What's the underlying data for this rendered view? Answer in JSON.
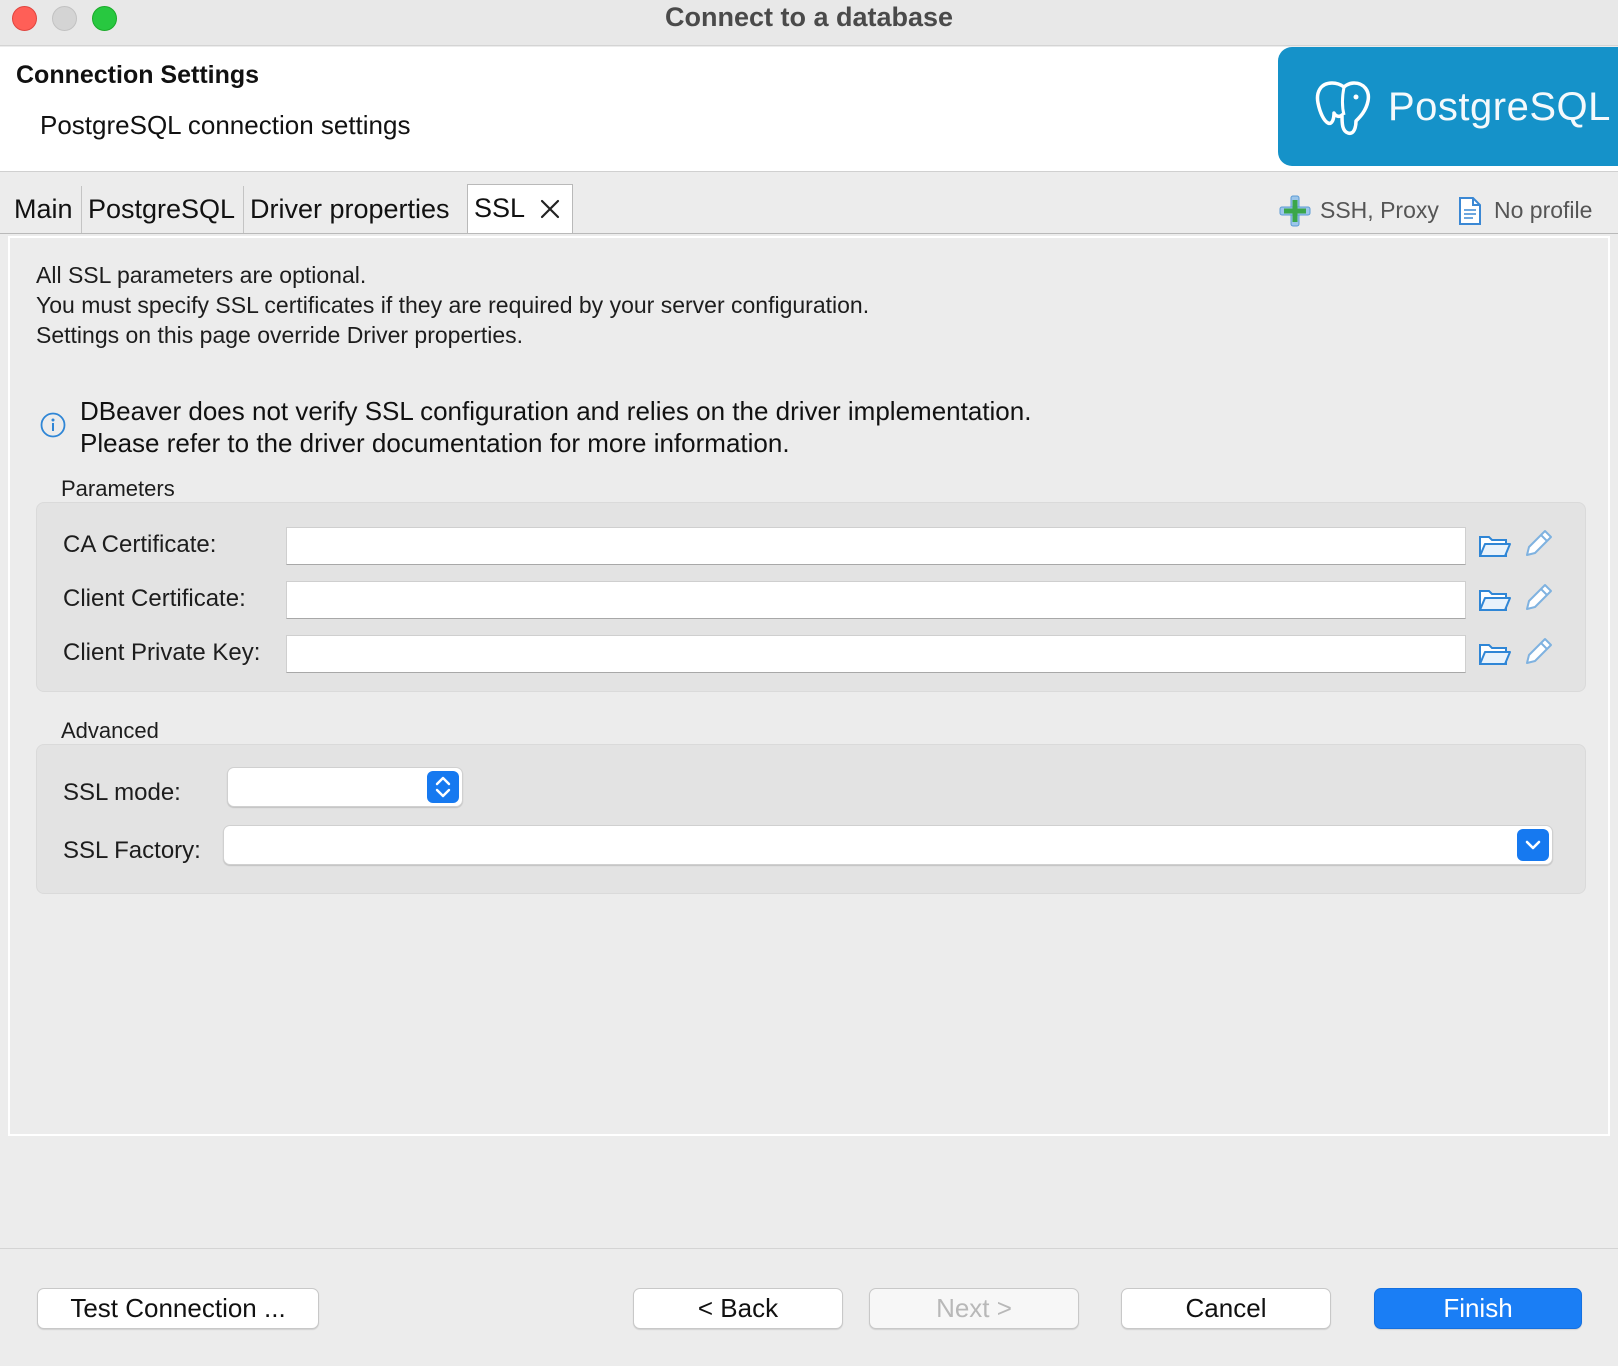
{
  "window": {
    "title": "Connect to a database"
  },
  "header": {
    "title": "Connection Settings",
    "subtitle": "PostgreSQL connection settings",
    "logo_text": "PostgreSQL",
    "logo_color": "#1592c9"
  },
  "tabs": [
    {
      "label": "Main",
      "active": false
    },
    {
      "label": "PostgreSQL",
      "active": false
    },
    {
      "label": "Driver properties",
      "active": false
    },
    {
      "label": "SSL",
      "active": true
    }
  ],
  "tools": {
    "ssh_proxy": "SSH, Proxy",
    "profile": "No profile"
  },
  "intro": {
    "line1": "All SSL parameters are optional.",
    "line2": "You must specify SSL certificates if they are required by your server configuration.",
    "line3": "Settings on this page override Driver properties."
  },
  "info": {
    "line1": "DBeaver does not verify SSL configuration and relies on the driver implementation.",
    "line2": "Please refer to the driver documentation for more information."
  },
  "parameters": {
    "label": "Parameters",
    "ca_certificate": {
      "label": "CA Certificate:",
      "value": ""
    },
    "client_certificate": {
      "label": "Client Certificate:",
      "value": ""
    },
    "client_private_key": {
      "label": "Client Private Key:",
      "value": ""
    }
  },
  "advanced": {
    "label": "Advanced",
    "ssl_mode": {
      "label": "SSL mode:",
      "value": ""
    },
    "ssl_factory": {
      "label": "SSL Factory:",
      "value": ""
    }
  },
  "buttons": {
    "test_connection": "Test Connection ...",
    "back": "< Back",
    "next": "Next >",
    "cancel": "Cancel",
    "finish": "Finish"
  },
  "colors": {
    "accent": "#1a7ef5",
    "icon_blue": "#2f86d6"
  }
}
